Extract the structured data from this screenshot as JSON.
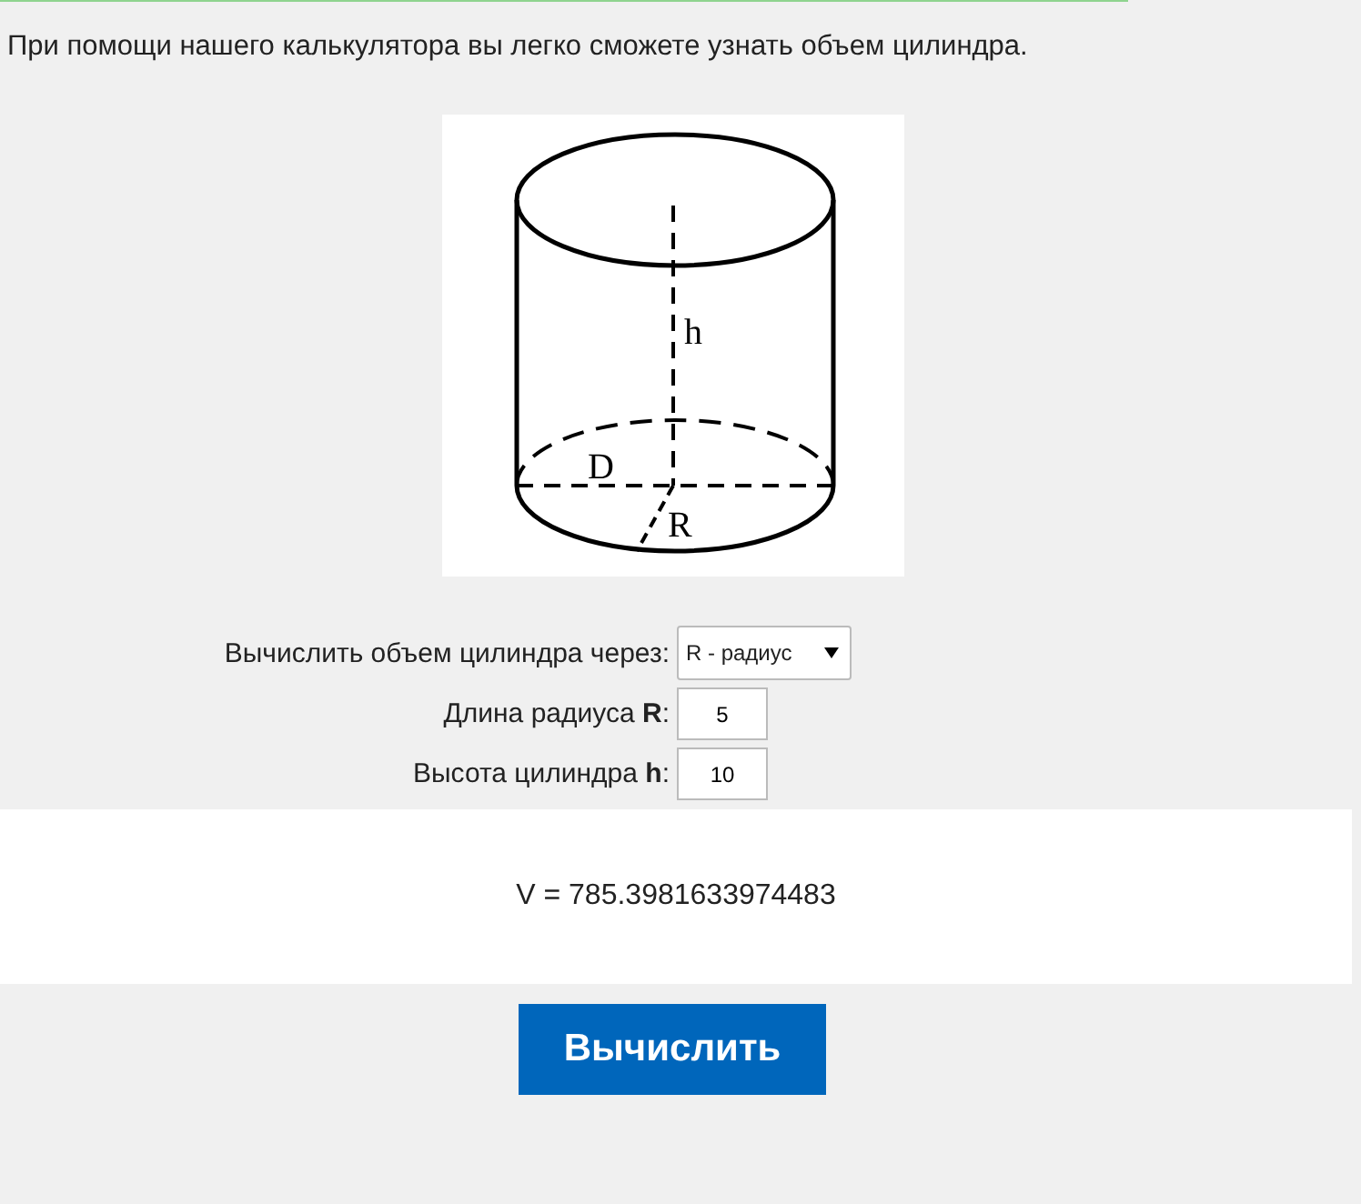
{
  "intro": "При помощи нашего калькулятора вы легко сможете узнать объем цилиндра.",
  "diagram": {
    "labels": [
      {
        "kind": "height",
        "text": "h"
      },
      {
        "kind": "diameter",
        "text": "D"
      },
      {
        "kind": "radius",
        "text": "R"
      }
    ]
  },
  "form": {
    "rows": [
      {
        "kind": "select",
        "label": "Вычислить объем цилиндра через:",
        "value": "R - радиус"
      },
      {
        "kind": "input",
        "label": "Длина радиуса **R**:",
        "value": "5"
      },
      {
        "kind": "input",
        "label": "Высота цилиндра **h**:",
        "value": "10"
      }
    ]
  },
  "result": "V = 785.3981633974483",
  "button": "Вычислить"
}
